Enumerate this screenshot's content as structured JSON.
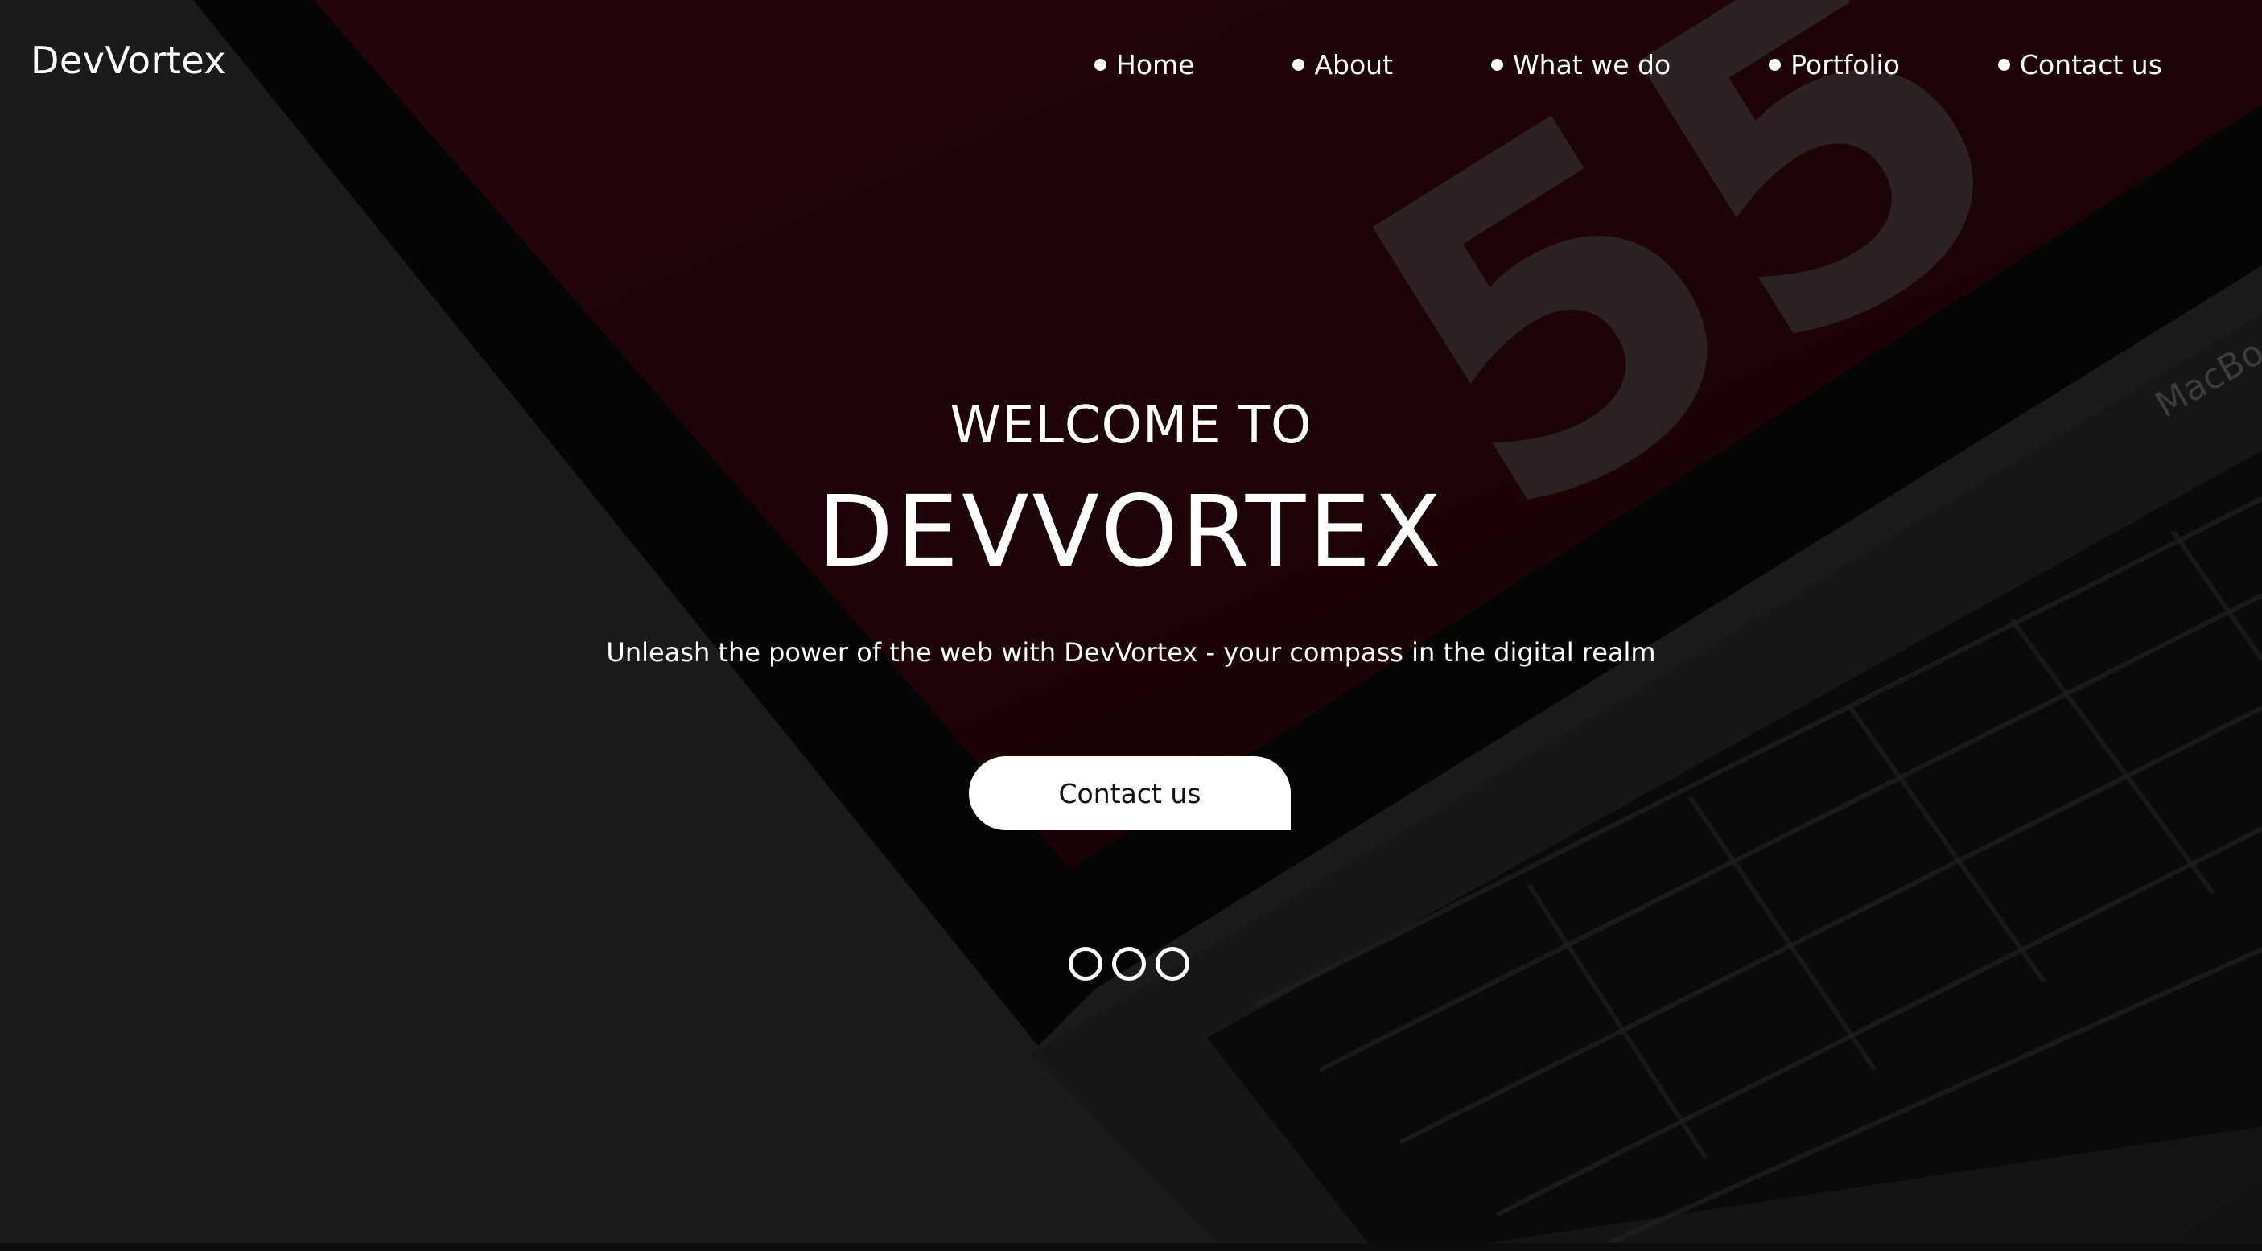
{
  "site": {
    "brand": "DevVortex"
  },
  "nav": {
    "items": [
      {
        "label": "Home"
      },
      {
        "label": "About"
      },
      {
        "label": "What we do"
      },
      {
        "label": "Portfolio"
      },
      {
        "label": "Contact us"
      }
    ]
  },
  "hero": {
    "welcome": "WELCOME TO",
    "title": "DEVVORTEX",
    "tagline": "Unleash the power of the web with DevVortex - your compass in the digital realm",
    "cta_label": "Contact us",
    "background_numerals": "55",
    "laptop_brand": "MacBo"
  },
  "carousel": {
    "indicator_count": 3
  },
  "colors": {
    "background": "#1b1b1b",
    "screen_red": "#1f0507",
    "text": "#ffffff",
    "button_bg": "#ffffff",
    "button_text": "#111111"
  }
}
